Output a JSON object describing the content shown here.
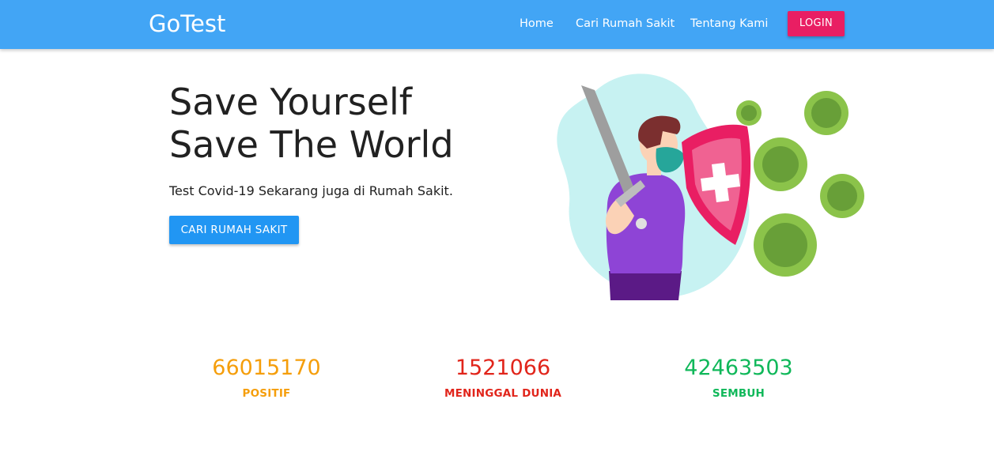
{
  "navbar": {
    "brand": "GoTest",
    "links": [
      {
        "label": "Home"
      },
      {
        "label": "Cari Rumah Sakit"
      },
      {
        "label": "Tentang Kami"
      }
    ],
    "login_label": "LOGIN",
    "colors": {
      "background": "#42a5f5",
      "login_button": "#e91e63"
    }
  },
  "hero": {
    "title_line1": "Save Yourself",
    "title_line2": "Save The World",
    "subtitle": "Test Covid-19 Sekarang juga di Rumah Sakit.",
    "cta_label": "CARI RUMAH SAKIT",
    "illustration": "hero-with-sword-shield-and-viruses",
    "colors": {
      "cta_button": "#2196f3"
    }
  },
  "stats": [
    {
      "value": "66015170",
      "label": "POSITIF",
      "color": "#f59e0b"
    },
    {
      "value": "1521066",
      "label": "MENINGGAL DUNIA",
      "color": "#e1251b"
    },
    {
      "value": "42463503",
      "label": "SEMBUH",
      "color": "#10b85a"
    }
  ]
}
